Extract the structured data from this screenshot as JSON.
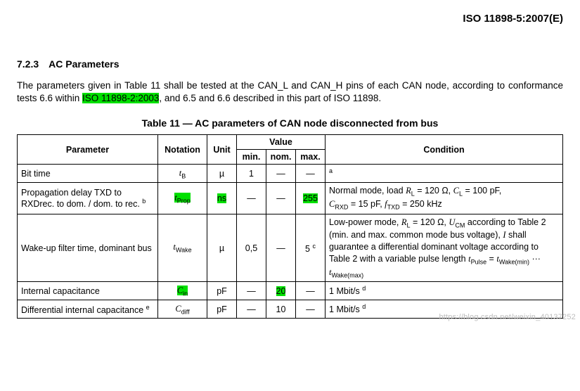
{
  "doc_id": "ISO 11898-5:2007(E)",
  "section": {
    "number": "7.2.3",
    "title": "AC Parameters"
  },
  "para": {
    "before_hl": "The parameters given in Table 11 shall be tested at the CAN_L and CAN_H pins of each CAN node, according to conformance tests 6.6 within ",
    "hl": "ISO 11898-2:2003",
    "after_hl": ", and 6.5 and 6.6 described in this part of ISO 11898.",
    "caption": "Table 11 — AC parameters of CAN node disconnected from bus"
  },
  "headers": {
    "parameter": "Parameter",
    "notation": "Notation",
    "unit": "Unit",
    "value": "Value",
    "min": "min.",
    "nom": "nom.",
    "max": "max.",
    "condition": "Condition"
  },
  "rows": {
    "bit_time": {
      "param": "Bit time",
      "not_sym": "t",
      "not_sub": "B",
      "unit": "µ",
      "min": "1",
      "nom": "—",
      "max": "—",
      "cond_sup": "a"
    },
    "prop_delay": {
      "param_before_sup": "Propagation delay TXD to RXDrec. to dom. / dom. to rec. ",
      "param_sup": "b",
      "not_sym": "t",
      "not_sub": "Prop",
      "unit": "ns",
      "min": "—",
      "nom": "—",
      "max": "255",
      "cond": {
        "t1": "Normal mode, load ",
        "rl_sym": "R",
        "rl_sub": "L",
        "rl_val": " = 120 Ω, ",
        "cl_sym": "C",
        "cl_sub": "L",
        "cl_val": " = 100 pF, ",
        "crxd_sym": "C",
        "crxd_sub": "RXD",
        "crxd_val": " =  15 pF, ",
        "ftxd_sym": "f",
        "ftxd_sub": "TXD",
        "ftxd_val": " = 250 kHz"
      }
    },
    "wake": {
      "param": "Wake-up filter time, dominant bus",
      "not_sym": "t",
      "not_sub": "Wake",
      "unit": "µ",
      "min": "0,5",
      "nom": "—",
      "max_val": "5 ",
      "max_sup": "c",
      "cond": {
        "t1": "Low-power mode, ",
        "rl_sym": "R",
        "rl_sub": "L",
        "rl_val": " = 120 Ω, ",
        "ucm_sym": "U",
        "ucm_sub": "CM",
        "t2": " according to Table 2 (min. and max. common mode bus voltage), ",
        "i_sym": "I",
        "t3": " shall guarantee a differential dominant voltage according to Table 2 with a variable pulse length ",
        "tp_sym": "t",
        "tp_sub": "Pulse",
        "eq": " = ",
        "twmin_sym": "t",
        "twmin_sub": "Wake(min)",
        "dots": " ··· ",
        "twmax_sym": "t",
        "twmax_sub": "Wake(max)"
      }
    },
    "cin": {
      "param": "Internal capacitance",
      "not_sym": "C",
      "not_sub": "in",
      "unit": "pF",
      "min": "—",
      "nom": "20",
      "max": "—",
      "cond_before_sup": "1 Mbit/s ",
      "cond_sup": "d"
    },
    "cdiff": {
      "param_before_sup": "Differential internal capacitance ",
      "param_sup": "e",
      "not_sym": "C",
      "not_sub": "diff",
      "unit": "pF",
      "min": "—",
      "nom": "10",
      "max": "—",
      "cond_before_sup": "1 Mbit/s ",
      "cond_sup": "d"
    }
  },
  "watermark": "https://blog.csdn.net/weixin_40137252"
}
